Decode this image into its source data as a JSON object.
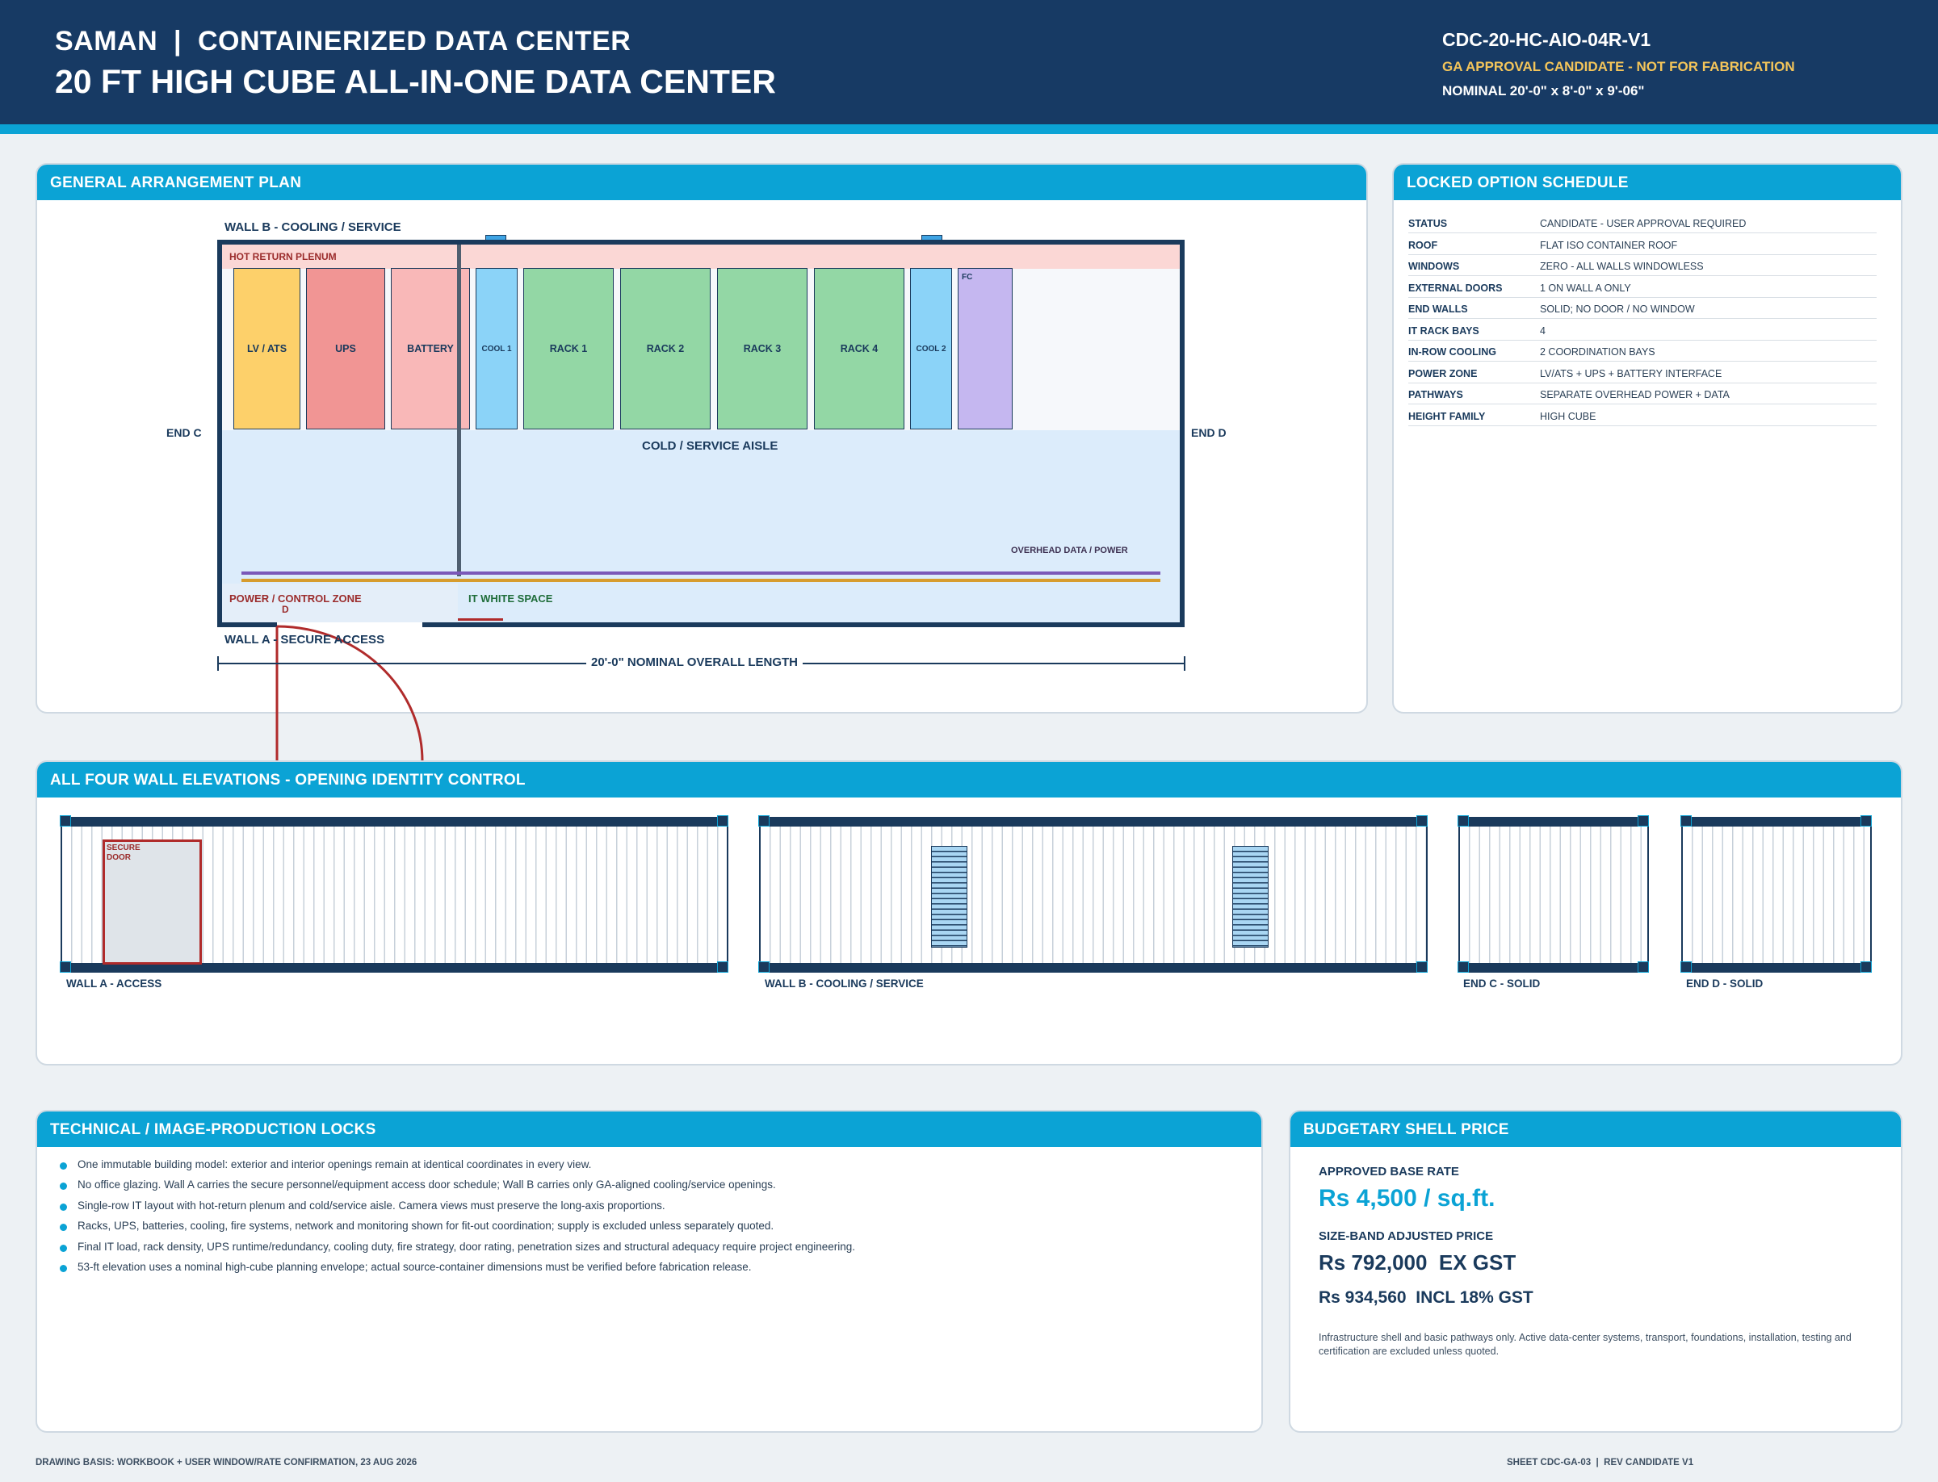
{
  "header": {
    "brand": "SAMAN  |  CONTAINERIZED DATA CENTER",
    "title": "20 FT HIGH CUBE ALL-IN-ONE DATA CENTER",
    "code": "CDC-20-HC-AIO-04R-V1",
    "status": "GA APPROVAL CANDIDATE - NOT FOR FABRICATION",
    "nominal": "NOMINAL 20'-0\" x 8'-0\" x 9'-06\""
  },
  "plan": {
    "heading": "GENERAL ARRANGEMENT PLAN",
    "wall_b": "WALL B - COOLING / SERVICE",
    "wall_a": "WALL A - SECURE ACCESS",
    "end_c": "END C",
    "end_d": "END D",
    "hot_plenum": "HOT RETURN PLENUM",
    "cold_aisle": "COLD / SERVICE AISLE",
    "overhead": "OVERHEAD DATA / POWER",
    "power_zone": "POWER / CONTROL ZONE",
    "door_tag": "D",
    "it_space": "IT WHITE SPACE",
    "dimension": "20'-0\" NOMINAL OVERALL LENGTH",
    "equipment": [
      {
        "label": "LV / ATS"
      },
      {
        "label": "UPS"
      },
      {
        "label": "BATTERY"
      },
      {
        "label": "COOL 1"
      },
      {
        "label": "RACK 1"
      },
      {
        "label": "RACK 2"
      },
      {
        "label": "RACK 3"
      },
      {
        "label": "RACK 4"
      },
      {
        "label": "COOL 2"
      },
      {
        "label": "FC"
      }
    ]
  },
  "schedule": {
    "heading": "LOCKED OPTION SCHEDULE",
    "rows": [
      {
        "key": "STATUS",
        "value": "CANDIDATE - USER APPROVAL REQUIRED"
      },
      {
        "key": "ROOF",
        "value": "FLAT ISO CONTAINER ROOF"
      },
      {
        "key": "WINDOWS",
        "value": "ZERO - ALL WALLS WINDOWLESS"
      },
      {
        "key": "EXTERNAL DOORS",
        "value": "1 ON WALL A ONLY"
      },
      {
        "key": "END WALLS",
        "value": "SOLID; NO DOOR / NO WINDOW"
      },
      {
        "key": "IT RACK BAYS",
        "value": "4"
      },
      {
        "key": "IN-ROW COOLING",
        "value": "2 COORDINATION BAYS"
      },
      {
        "key": "POWER ZONE",
        "value": "LV/ATS + UPS + BATTERY INTERFACE"
      },
      {
        "key": "PATHWAYS",
        "value": "SEPARATE OVERHEAD POWER + DATA"
      },
      {
        "key": "HEIGHT FAMILY",
        "value": "HIGH CUBE"
      }
    ]
  },
  "elevations": {
    "heading": "ALL FOUR WALL ELEVATIONS - OPENING IDENTITY CONTROL",
    "secure_door": "SECURE\nDOOR",
    "wall_a": "WALL A - ACCESS",
    "wall_b": "WALL B - COOLING / SERVICE",
    "end_c": "END C - SOLID",
    "end_d": "END D - SOLID"
  },
  "locks": {
    "heading": "TECHNICAL / IMAGE-PRODUCTION LOCKS",
    "items": [
      "One immutable building model: exterior and interior openings remain at identical coordinates in every view.",
      "No office glazing. Wall A carries the secure personnel/equipment access door schedule; Wall B carries only GA-aligned cooling/service openings.",
      "Single-row IT layout with hot-return plenum and cold/service aisle. Camera views must preserve the long-axis proportions.",
      "Racks, UPS, batteries, cooling, fire systems, network and monitoring shown for fit-out coordination; supply is excluded unless separately quoted.",
      "Final IT load, rack density, UPS runtime/redundancy, cooling duty, fire strategy, door rating, penetration sizes and structural adequacy require project engineering.",
      "53-ft elevation uses a nominal high-cube planning envelope; actual source-container dimensions must be verified before fabrication release."
    ]
  },
  "price": {
    "heading": "BUDGETARY SHELL PRICE",
    "base_label": "APPROVED BASE RATE",
    "base_value": "Rs 4,500 / sq.ft.",
    "adjusted_label": "SIZE-BAND ADJUSTED PRICE",
    "ex_gst": "Rs 792,000  EX GST",
    "incl_gst": "Rs 934,560  INCL 18% GST",
    "note": "Infrastructure shell and basic pathways only. Active data-center systems, transport, foundations, installation, testing and certification are excluded unless quoted."
  },
  "footer": {
    "left": "DRAWING BASIS: WORKBOOK + USER WINDOW/RATE CONFIRMATION, 23 AUG 2026",
    "right": "SHEET CDC-GA-03  |  REV CANDIDATE V1"
  }
}
